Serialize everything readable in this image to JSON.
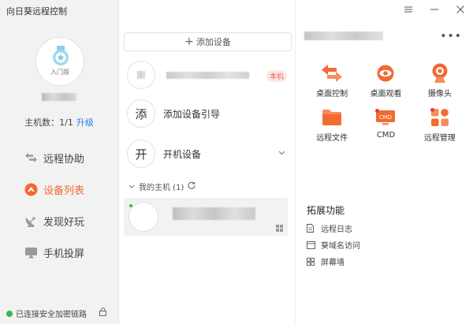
{
  "app": {
    "title": "向日葵远程控制"
  },
  "profile": {
    "level": "入门版",
    "host_count": "主机数：1/1",
    "upgrade": "升级"
  },
  "nav": [
    {
      "label": "远程协助",
      "icon": "swap-arrows-icon"
    },
    {
      "label": "设备列表",
      "icon": "device-list-icon",
      "active": true
    },
    {
      "label": "发现好玩",
      "icon": "satellite-dish-icon"
    },
    {
      "label": "手机投屏",
      "icon": "screen-cast-icon"
    }
  ],
  "status": {
    "text": "已连接安全加密链路"
  },
  "middle": {
    "add_device": "添加设备",
    "self_tag": "本机",
    "add_guide": {
      "glyph": "添",
      "label": "添加设备引导"
    },
    "wake": {
      "glyph": "开",
      "label": "开机设备"
    },
    "group": "我的主机 (1)"
  },
  "functions": [
    {
      "label": "桌面控制",
      "icon": "desktop-control-icon"
    },
    {
      "label": "桌面观看",
      "icon": "desktop-view-icon"
    },
    {
      "label": "摄像头",
      "icon": "camera-icon"
    },
    {
      "label": "远程文件",
      "icon": "folder-icon"
    },
    {
      "label": "CMD",
      "icon": "cmd-icon",
      "icon_text": "CMD"
    },
    {
      "label": "远程管理",
      "icon": "remote-manage-icon"
    }
  ],
  "extensions": {
    "title": "拓展功能",
    "items": [
      {
        "label": "远程日志",
        "icon": "log-icon"
      },
      {
        "label": "葵域名访问",
        "icon": "domain-icon"
      },
      {
        "label": "屏幕墙",
        "icon": "grid-icon"
      }
    ]
  },
  "colors": {
    "accent": "#f36a32",
    "link": "#2b7de9",
    "online": "#3bb54a",
    "badge": "#e73b3b"
  }
}
